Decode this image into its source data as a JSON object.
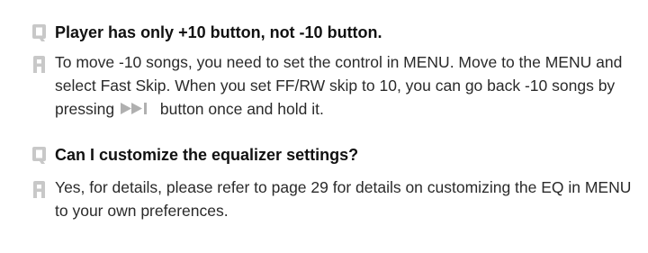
{
  "faq": [
    {
      "q_badge": "Q",
      "question": "Player has only +10 button, not -10 button.",
      "a_badge": "A",
      "answer_parts": [
        "To move -10 songs, you need to set the control in MENU. Move to the MENU and select Fast Skip. When you set FF/RW skip to 10, you can go back -10 songs by pressing ",
        " button once and hold it."
      ],
      "inline_icon": "fast-forward-skip-icon"
    },
    {
      "q_badge": "Q",
      "question": "Can I customize the equalizer settings?",
      "a_badge": "A",
      "answer": "Yes, for details, please refer to page 29 for details on customizing the EQ in MENU to your own preferences."
    }
  ],
  "colors": {
    "badge_gray": "#c8c8c8",
    "text": "#1a1a1a"
  }
}
